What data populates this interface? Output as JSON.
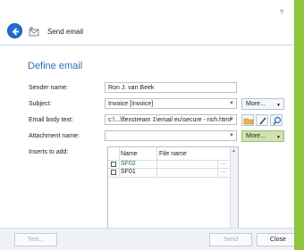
{
  "titlebar": {
    "help": "?",
    "close": "×"
  },
  "header": {
    "title": "Send email"
  },
  "section_title": "Define email",
  "form": {
    "sender_label": "Sender name:",
    "sender_value": "Ron J. van Beek",
    "subject_label": "Subject:",
    "subject_value": "Invoice [Invoice]",
    "subject_more": "More...",
    "body_label": "Email body text:",
    "body_value": "c:\\...\\flexstream 1\\email eu\\secure - rich.html",
    "attachment_label": "Attachment name:",
    "attachment_value": "",
    "attachment_more": "More...",
    "inserts_label": "Inserts to add:"
  },
  "inserts_table": {
    "columns": [
      "Name",
      "File name"
    ],
    "rows": [
      {
        "name": "SF02",
        "file": "",
        "browse": "..."
      },
      {
        "name": "SF01",
        "file": "",
        "browse": "..."
      }
    ]
  },
  "footer": {
    "test": "Test...",
    "send": "Send",
    "close": "Close"
  },
  "colors": {
    "accent": "#2c6fb3",
    "green": "#8fc43f"
  }
}
